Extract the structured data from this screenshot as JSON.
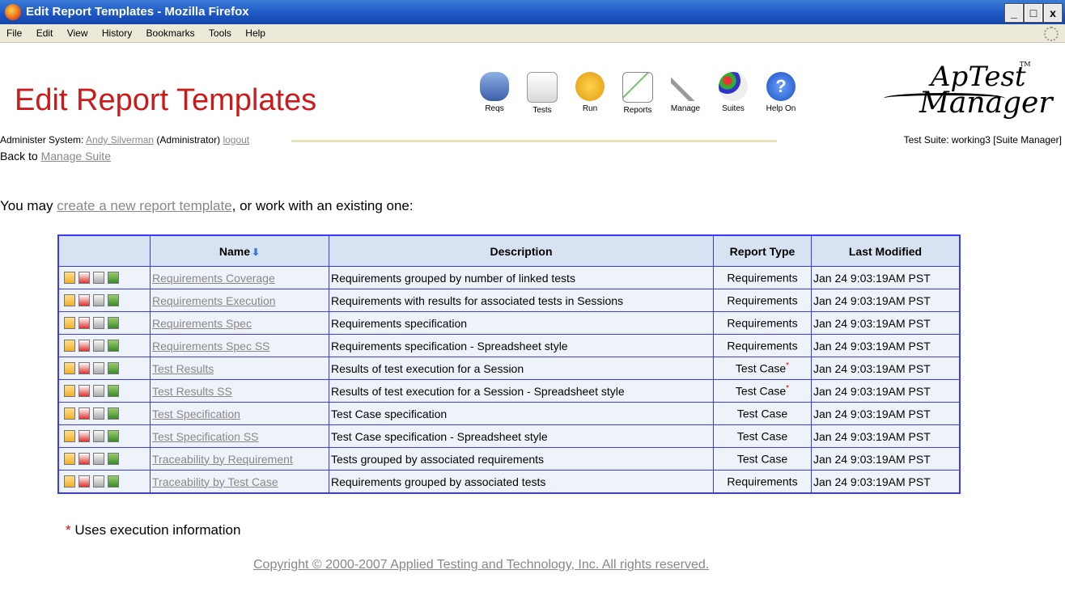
{
  "window": {
    "title": "Edit Report Templates - Mozilla Firefox",
    "controls": [
      "_",
      "□",
      "x"
    ]
  },
  "menu": [
    "File",
    "Edit",
    "View",
    "History",
    "Bookmarks",
    "Tools",
    "Help"
  ],
  "page": {
    "title": "Edit Report Templates",
    "nav": [
      {
        "label": "Reqs",
        "icon": "database-icon",
        "color": "#5a7fc0"
      },
      {
        "label": "Tests",
        "icon": "notepad-icon",
        "color": "#7ab04a"
      },
      {
        "label": "Run",
        "icon": "footprints-icon",
        "color": "#f0b020"
      },
      {
        "label": "Reports",
        "icon": "chart-icon",
        "color": "#4aa84a"
      },
      {
        "label": "Manage",
        "icon": "tools-icon",
        "color": "#888888"
      },
      {
        "label": "Suites",
        "icon": "palette-icon",
        "color": "#d04a8a"
      },
      {
        "label": "Help On",
        "icon": "help-icon",
        "color": "#2a6ad0"
      }
    ],
    "logo": {
      "line1": "ApTest",
      "line2": "Manager",
      "tm": "TM"
    },
    "admin": {
      "prefix": "Administer System: ",
      "user": "Andy Silverman",
      "role": " (Administrator) ",
      "logout": "logout"
    },
    "suite": "Test Suite: working3 [Suite Manager]",
    "back": {
      "prefix": "Back to ",
      "link": "Manage Suite"
    },
    "intro": {
      "prefix": "You may ",
      "link": "create a new report template",
      "suffix": ", or work with an existing one:"
    },
    "table": {
      "headers": [
        "Name",
        "Description",
        "Report Type",
        "Last Modified"
      ],
      "rows": [
        {
          "name": "Requirements Coverage",
          "desc": "Requirements grouped by number of linked tests",
          "type": "Requirements",
          "star": "",
          "mod": "Jan 24 9:03:19AM PST"
        },
        {
          "name": "Requirements Execution",
          "desc": "Requirements with results for associated tests in Sessions",
          "type": "Requirements",
          "star": "",
          "mod": "Jan 24 9:03:19AM PST"
        },
        {
          "name": "Requirements Spec",
          "desc": "Requirements specification",
          "type": "Requirements",
          "star": "",
          "mod": "Jan 24 9:03:19AM PST"
        },
        {
          "name": "Requirements Spec SS",
          "desc": "Requirements specification - Spreadsheet style",
          "type": "Requirements",
          "star": "",
          "mod": "Jan 24 9:03:19AM PST"
        },
        {
          "name": "Test Results",
          "desc": "Results of test execution for a Session",
          "type": "Test Case",
          "star": "*",
          "mod": "Jan 24 9:03:19AM PST"
        },
        {
          "name": "Test Results SS",
          "desc": "Results of test execution for a Session - Spreadsheet style",
          "type": "Test Case",
          "star": "*",
          "mod": "Jan 24 9:03:19AM PST"
        },
        {
          "name": "Test Specification",
          "desc": "Test Case specification",
          "type": "Test Case",
          "star": "",
          "mod": "Jan 24 9:03:19AM PST"
        },
        {
          "name": "Test Specification SS",
          "desc": "Test Case specification - Spreadsheet style",
          "type": "Test Case",
          "star": "",
          "mod": "Jan 24 9:03:19AM PST"
        },
        {
          "name": "Traceability by Requirement",
          "desc": "Tests grouped by associated requirements",
          "type": "Test Case",
          "star": "",
          "mod": "Jan 24 9:03:19AM PST"
        },
        {
          "name": "Traceability by Test Case",
          "desc": "Requirements grouped by associated tests",
          "type": "Requirements",
          "star": "",
          "mod": "Jan 24 9:03:19AM PST"
        }
      ]
    },
    "footnote": {
      "star": "*",
      "text": " Uses execution information"
    },
    "copyright": "Copyright © 2000-2007 Applied Testing and Technology, Inc. All rights reserved."
  }
}
